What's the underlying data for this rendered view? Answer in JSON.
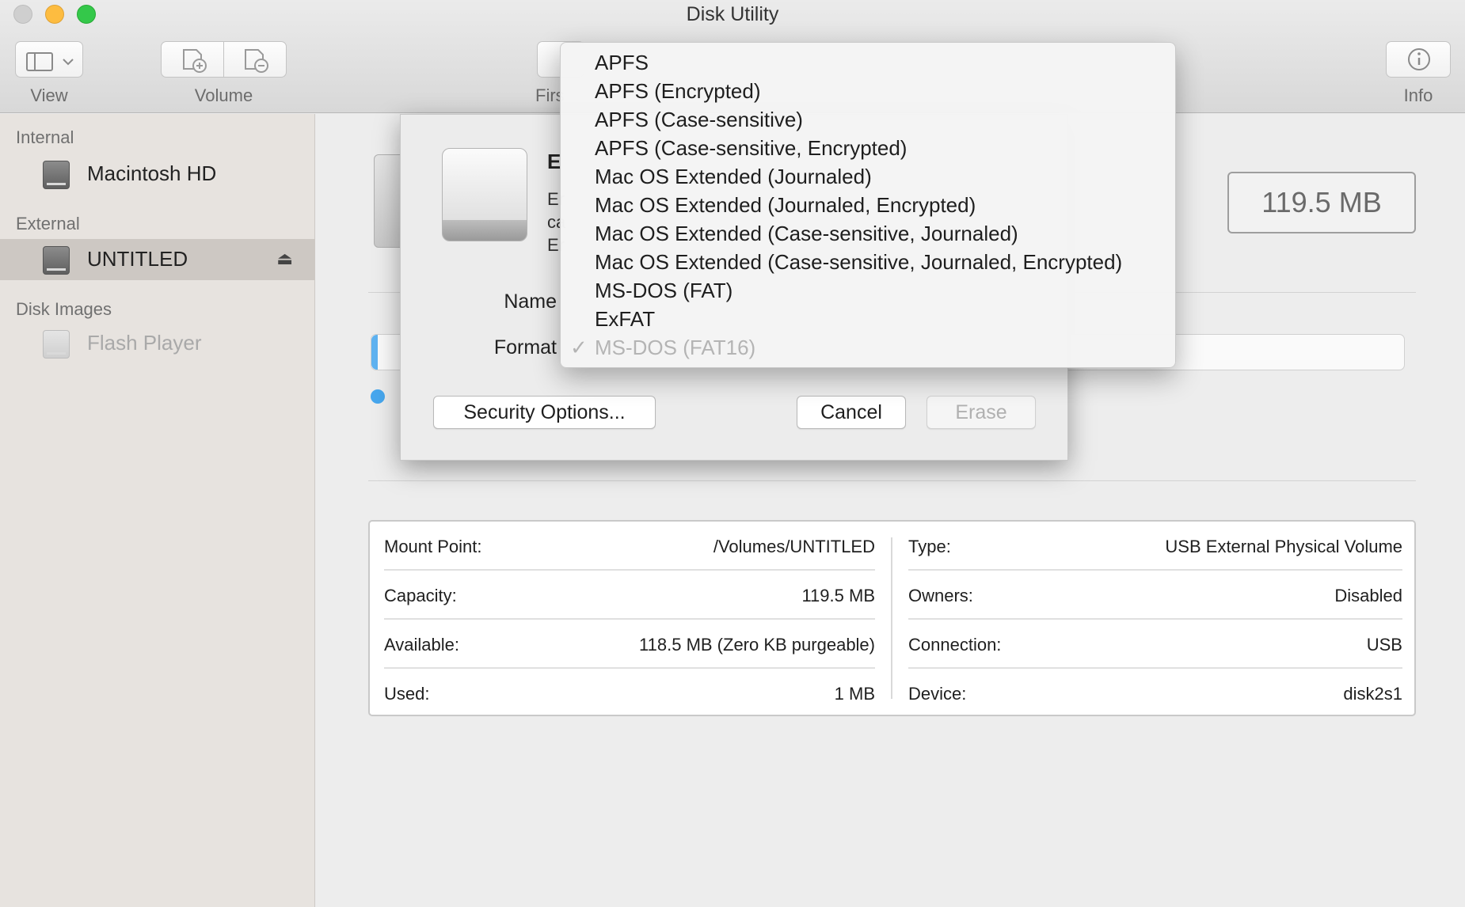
{
  "window": {
    "title": "Disk Utility"
  },
  "toolbar": {
    "view_label": "View",
    "volume_label": "Volume",
    "first_aid_label_partial": "Firs",
    "info_label": "Info"
  },
  "sidebar": {
    "sections": [
      {
        "header": "Internal",
        "items": [
          {
            "label": "Macintosh HD"
          }
        ]
      },
      {
        "header": "External",
        "items": [
          {
            "label": "UNTITLED"
          }
        ]
      },
      {
        "header": "Disk Images",
        "items": [
          {
            "label": "Flash Player"
          }
        ]
      }
    ]
  },
  "volume": {
    "size": "119.5 MB",
    "usage_used_fraction": 0.008
  },
  "info": {
    "left": [
      {
        "key": "Mount Point:",
        "value": "/Volumes/UNTITLED"
      },
      {
        "key": "Capacity:",
        "value": "119.5 MB"
      },
      {
        "key": "Available:",
        "value": "118.5 MB (Zero KB purgeable)"
      },
      {
        "key": "Used:",
        "value": "1 MB"
      }
    ],
    "right": [
      {
        "key": "Type:",
        "value": "USB External Physical Volume"
      },
      {
        "key": "Owners:",
        "value": "Disabled"
      },
      {
        "key": "Connection:",
        "value": "USB"
      },
      {
        "key": "Device:",
        "value": "disk2s1"
      }
    ]
  },
  "sheet": {
    "title_partial": "E",
    "desc_partial": [
      "Er",
      "ca",
      "Er"
    ],
    "name_label": "Name",
    "format_label": "Format",
    "security_button": "Security Options...",
    "cancel_button": "Cancel",
    "erase_button": "Erase"
  },
  "format_menu": {
    "items": [
      "APFS",
      "APFS (Encrypted)",
      "APFS (Case-sensitive)",
      "APFS (Case-sensitive, Encrypted)",
      "Mac OS Extended (Journaled)",
      "Mac OS Extended (Journaled, Encrypted)",
      "Mac OS Extended (Case-sensitive, Journaled)",
      "Mac OS Extended (Case-sensitive, Journaled, Encrypted)",
      "MS-DOS (FAT)",
      "ExFAT",
      "MS-DOS (FAT16)"
    ],
    "selected": "MS-DOS (FAT16)",
    "check_glyph": "✓"
  },
  "colors": {
    "usage_blue": "#5fb3f1",
    "traffic_min": "#fdbc40",
    "traffic_max": "#34c84a"
  },
  "icons": {
    "view": "sidebar-view-icon",
    "add_volume": "add-volume-icon",
    "remove_volume": "remove-volume-icon",
    "info": "info-icon",
    "eject": "eject-icon"
  }
}
